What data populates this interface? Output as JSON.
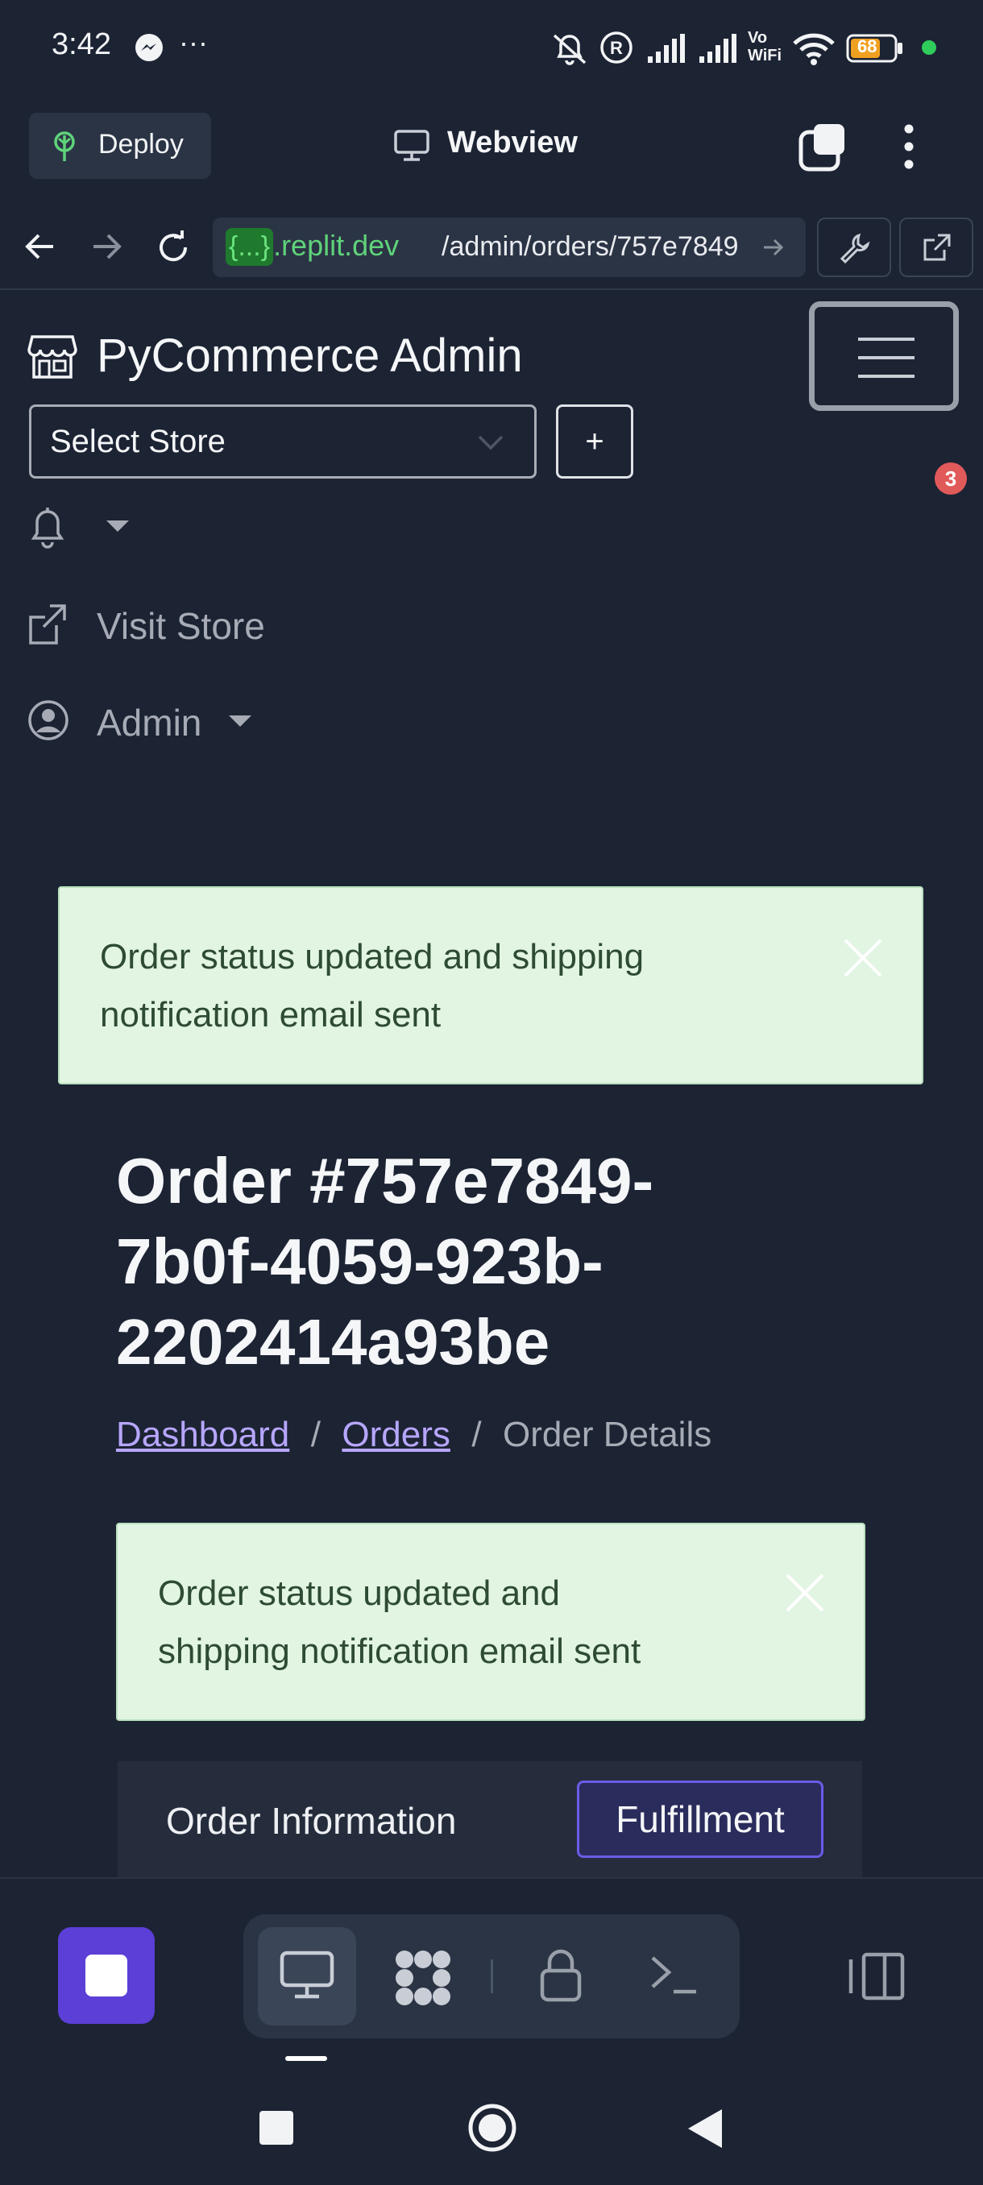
{
  "status_bar": {
    "time": "3:42",
    "more": "···",
    "icons": [
      "messenger-icon",
      "mute-icon",
      "registered-icon",
      "signal-icon",
      "signal-icon",
      "vowifi-icon",
      "wifi-icon",
      "battery-icon",
      "privacy-dot-icon"
    ],
    "vowifi_top": "Vo",
    "vowifi_bottom": "WiFi",
    "battery": "68"
  },
  "replit_bar": {
    "deploy_label": "Deploy",
    "title": "Webview"
  },
  "url_bar": {
    "host_badge": "{...}",
    "host_suffix": ".replit.dev",
    "path": "/admin/orders/757e7849"
  },
  "admin": {
    "brand": "PyCommerce Admin",
    "store_select": "Select Store",
    "add_store": "+",
    "notification_count": "3",
    "visit_store": "Visit Store",
    "user_menu": "Admin"
  },
  "alerts": {
    "top_line1": "Order status updated and shipping",
    "top_line2": "notification email sent",
    "inner_line1": "Order status updated and",
    "inner_line2": "shipping notification email sent"
  },
  "order": {
    "title_line1": "Order #757e7849-",
    "title_line2": "7b0f-4059-923b-",
    "title_line3": "2202414a93be"
  },
  "breadcrumb": {
    "dashboard": "Dashboard",
    "sep": "/",
    "orders": "Orders",
    "current": "Order Details"
  },
  "tabs": {
    "order_information": "Order Information",
    "fulfillment": "Fulfillment"
  },
  "colors": {
    "background": "#1c2333",
    "alert_bg": "#e2f5e3",
    "accent": "#6b5ce7",
    "link": "#b7a6ff",
    "stop_button": "#5b3fd6"
  }
}
